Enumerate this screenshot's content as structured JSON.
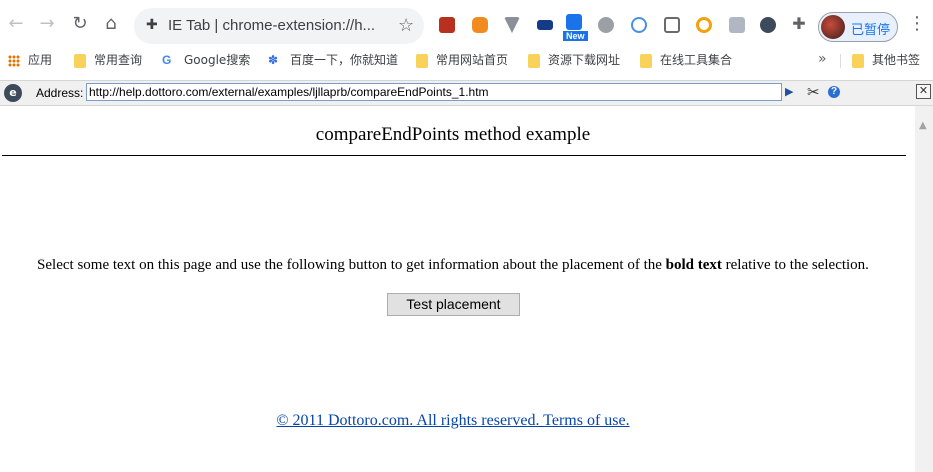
{
  "browser": {
    "nav": {
      "back": "←",
      "forward": "→",
      "reload": "↻",
      "home": "⌂"
    },
    "omnibox": {
      "text": "IE Tab  |  chrome-extension://h...",
      "star": "☆"
    },
    "extensions": [
      {
        "name": "fe-helper-icon",
        "color": "#b7311e"
      },
      {
        "name": "chat-ext-icon",
        "color": "#f28b1f"
      },
      {
        "name": "vpn-ext-icon",
        "color": "#8a8f98"
      },
      {
        "name": "flag-ext-icon",
        "color": "#153b87"
      },
      {
        "name": "new-ext-icon",
        "color": "#1a73e8"
      },
      {
        "name": "cloud-ext-icon",
        "color": "#9aa0a6"
      },
      {
        "name": "check-ext-icon",
        "color": "#4a90e2"
      },
      {
        "name": "window-ext-icon",
        "color": "#6b6b6b"
      },
      {
        "name": "ring-ext-icon",
        "color": "#f2a20c"
      },
      {
        "name": "bird-ext-icon",
        "color": "#b0b7c3"
      },
      {
        "name": "e-ext-icon",
        "color": "#3c4a5c"
      }
    ],
    "extensions_puzzle": "✚",
    "new_badge": "New",
    "profile_label": "已暂停",
    "menu": "⋮"
  },
  "bookmarks": {
    "items": [
      {
        "label": "应用",
        "type": "apps"
      },
      {
        "label": "常用查询",
        "type": "folder"
      },
      {
        "label": "Google搜索",
        "type": "google"
      },
      {
        "label": "百度一下，你就知道",
        "type": "paw"
      },
      {
        "label": "常用网站首页",
        "type": "folder"
      },
      {
        "label": "资源下载网址",
        "type": "folder"
      },
      {
        "label": "在线工具集合",
        "type": "folder"
      }
    ],
    "more": "»",
    "other": "其他书签"
  },
  "ietab": {
    "logo": "e",
    "address_label": "Address:",
    "url": "http://help.dottoro.com/external/examples/ljllaprb/compareEndPoints_1.htm",
    "go": "▶",
    "tools": "✂",
    "help": "?",
    "close": "✕"
  },
  "page": {
    "title": "compareEndPoints method example",
    "instructions_before": "Select some text on this page and use the following button to get information about the placement of the ",
    "instructions_bold": "bold text",
    "instructions_after": " relative to the selection.",
    "button_label": "Test placement",
    "footer": "© 2011 Dottoro.com. All rights reserved. Terms of use."
  },
  "scroll_up": "▲"
}
